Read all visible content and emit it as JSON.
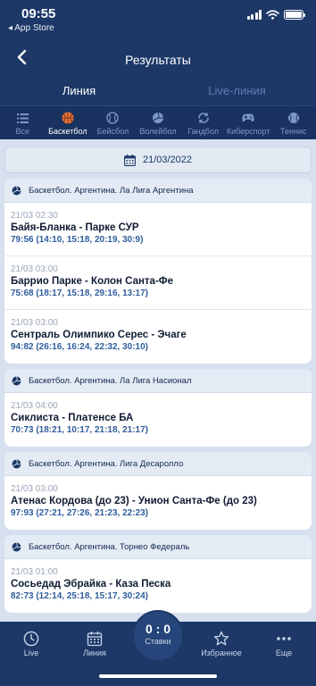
{
  "status_bar": {
    "time": "09:55",
    "back_app": "◂ App Store"
  },
  "header": {
    "title": "Результаты"
  },
  "line_tabs": [
    {
      "label": "Линия",
      "active": true
    },
    {
      "label": "Live-линия",
      "active": false
    }
  ],
  "sport_tabs": [
    {
      "label": "Все",
      "icon": "list-icon"
    },
    {
      "label": "Баскетбол",
      "icon": "basketball-icon",
      "active": true
    },
    {
      "label": "Бейсбол",
      "icon": "baseball-icon"
    },
    {
      "label": "Волейбол",
      "icon": "volleyball-icon"
    },
    {
      "label": "Гандбол",
      "icon": "handball-icon"
    },
    {
      "label": "Киберспорт",
      "icon": "gamepad-icon"
    },
    {
      "label": "Теннис",
      "icon": "tennis-icon"
    }
  ],
  "date": "21/03/2022",
  "groups": [
    {
      "title": "Баскетбол. Аргентина. Ла Лига Аргентина",
      "matches": [
        {
          "time": "21/03 02:30",
          "teams": "Байя-Бланка - Парке СУР",
          "score": "79:56 (14:10, 15:18, 20:19, 30:9)"
        },
        {
          "time": "21/03 03:00",
          "teams": "Баррио Парке - Колон Санта-Фе",
          "score": "75:68 (18:17, 15:18, 29:16, 13:17)"
        },
        {
          "time": "21/03 03:00",
          "teams": "Сентраль Олимпико Серес - Эчаге",
          "score": "94:82 (26:16, 16:24, 22:32, 30:10)"
        }
      ]
    },
    {
      "title": "Баскетбол. Аргентина. Ла Лига Насионал",
      "matches": [
        {
          "time": "21/03 04:00",
          "teams": "Сиклиста - Платенсе БА",
          "score": "70:73 (18:21, 10:17, 21:18, 21:17)"
        }
      ]
    },
    {
      "title": "Баскетбол. Аргентина. Лига Десаролло",
      "matches": [
        {
          "time": "21/03 03:00",
          "teams": "Атенас Кордова (до 23) - Унион Санта-Фе (до 23)",
          "score": "97:93 (27:21, 27:26, 21:23, 22:23)"
        }
      ]
    },
    {
      "title": "Баскетбол. Аргентина. Торнео Федераль",
      "matches": [
        {
          "time": "21/03 01:00",
          "teams": "Сосьедад Эбрайка - Каза Песка",
          "score": "82:73 (12:14, 25:18, 15:17, 30:24)"
        }
      ]
    }
  ],
  "bottom_nav": {
    "live": "Live",
    "line": "Линия",
    "bets_count": "0 : 0",
    "bets": "Ставки",
    "favorites": "Избранное",
    "more": "Еще"
  }
}
